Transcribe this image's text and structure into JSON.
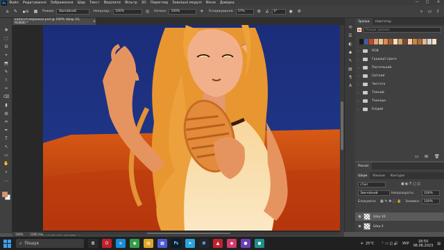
{
  "app": {
    "logo": "Ps",
    "menu": [
      "Файл",
      "Редагування",
      "Зображення",
      "Шар",
      "Текст",
      "Виділити",
      "Фільтр",
      "3D",
      "Перегляд",
      "Зовнішні модулі",
      "Вікно",
      "Довідка"
    ],
    "window_controls": [
      "—",
      "□",
      "✕"
    ]
  },
  "options_bar": {
    "brush_size": "40",
    "mode_label": "Режим:",
    "mode_value": "Звичайний",
    "opacity_label": "Непрозор.:",
    "opacity_value": "100%",
    "flow_label": "Натиск:",
    "flow_value": "100%",
    "smoothing_label": "Згладжування:",
    "smoothing_value": "37%",
    "angle_value": "0°"
  },
  "document": {
    "tab_title": "колосся верониха.psd @ 100% (Шар 10, RGB/8) *",
    "tab_close": "×",
    "zoom": "100%",
    "doc_info": "1280 пікс. x 1788 пікс. (300 ppi)"
  },
  "tools": [
    "✥",
    "⬚",
    "ʘ",
    "⌖",
    "⬒",
    "✎",
    "⌇",
    "✑",
    "⌫",
    "▮",
    "◍",
    "♒",
    "✒",
    "T",
    "↖",
    "▭",
    "✋",
    "⌕",
    "…"
  ],
  "colors": {
    "foreground": "#f08b50",
    "background": "#ffffff",
    "accent": "#31a8ff"
  },
  "swatches_panel": {
    "tabs": [
      "Зразки",
      "Навігатор"
    ],
    "search_placeholder": "Пошук зразків",
    "recent": [
      "#1b1b1b",
      "#3b5ea8",
      "#c64a1f",
      "#e1a47f",
      "#efc58f",
      "#d98a4c",
      "#a85a34",
      "#ffe1b5",
      "#d2a06a",
      "#7a4a2a",
      "#f3d1b0",
      "#c9873f",
      "#b06a3c",
      "#e8b98a",
      "#d9d9d9",
      "#f4e3c7"
    ],
    "groups": [
      "RGB",
      "Градації сірого",
      "Пастельний",
      "Світлий",
      "Чистота",
      "Темний",
      "Темніше",
      "Блідий"
    ]
  },
  "layers_panel": {
    "header_tab": "Пензлі",
    "tabs": [
      "Шари",
      "Канали",
      "Контури"
    ],
    "filter": "Тип",
    "blend_mode": "Звичайний",
    "opacity_label": "Непрозорість:",
    "opacity_value": "100%",
    "lock_label": "Блокувати:",
    "fill_label": "Заливка:",
    "fill_value": "100%",
    "layers": [
      {
        "name": "Шар 10",
        "active": true
      },
      {
        "name": "Шар 4",
        "active": false
      }
    ]
  },
  "taskbar": {
    "search_text": "Пошук",
    "apps": [
      {
        "icon": "task-view-icon",
        "glyph": "⧉",
        "color": "#2b2b2b"
      },
      {
        "icon": "opera-icon",
        "glyph": "O",
        "color": "#c0202b"
      },
      {
        "icon": "edge-icon",
        "glyph": "e",
        "color": "#1c8bd6"
      },
      {
        "icon": "chrome-icon",
        "glyph": "◉",
        "color": "#2f9e44"
      },
      {
        "icon": "explorer-icon",
        "glyph": "▤",
        "color": "#e0a526"
      },
      {
        "icon": "store-icon",
        "glyph": "▦",
        "color": "#4b5bd6"
      },
      {
        "icon": "photoshop-icon",
        "glyph": "Ps",
        "color": "#001e36"
      },
      {
        "icon": "telegram-icon",
        "glyph": "➤",
        "color": "#2aa3df"
      },
      {
        "icon": "steam-icon",
        "glyph": "⚙",
        "color": "#1b2838"
      },
      {
        "icon": "app-red-icon",
        "glyph": "▲",
        "color": "#c2202f"
      },
      {
        "icon": "app-pink-icon",
        "glyph": "◆",
        "color": "#d23a6e"
      },
      {
        "icon": "app-purple-icon",
        "glyph": "●",
        "color": "#6b3fb4"
      },
      {
        "icon": "app-teal-icon",
        "glyph": "◼",
        "color": "#1f8d8d"
      }
    ],
    "temperature": "25°C",
    "language": "УКР",
    "time": "18:50",
    "date": "06.06.2023"
  }
}
